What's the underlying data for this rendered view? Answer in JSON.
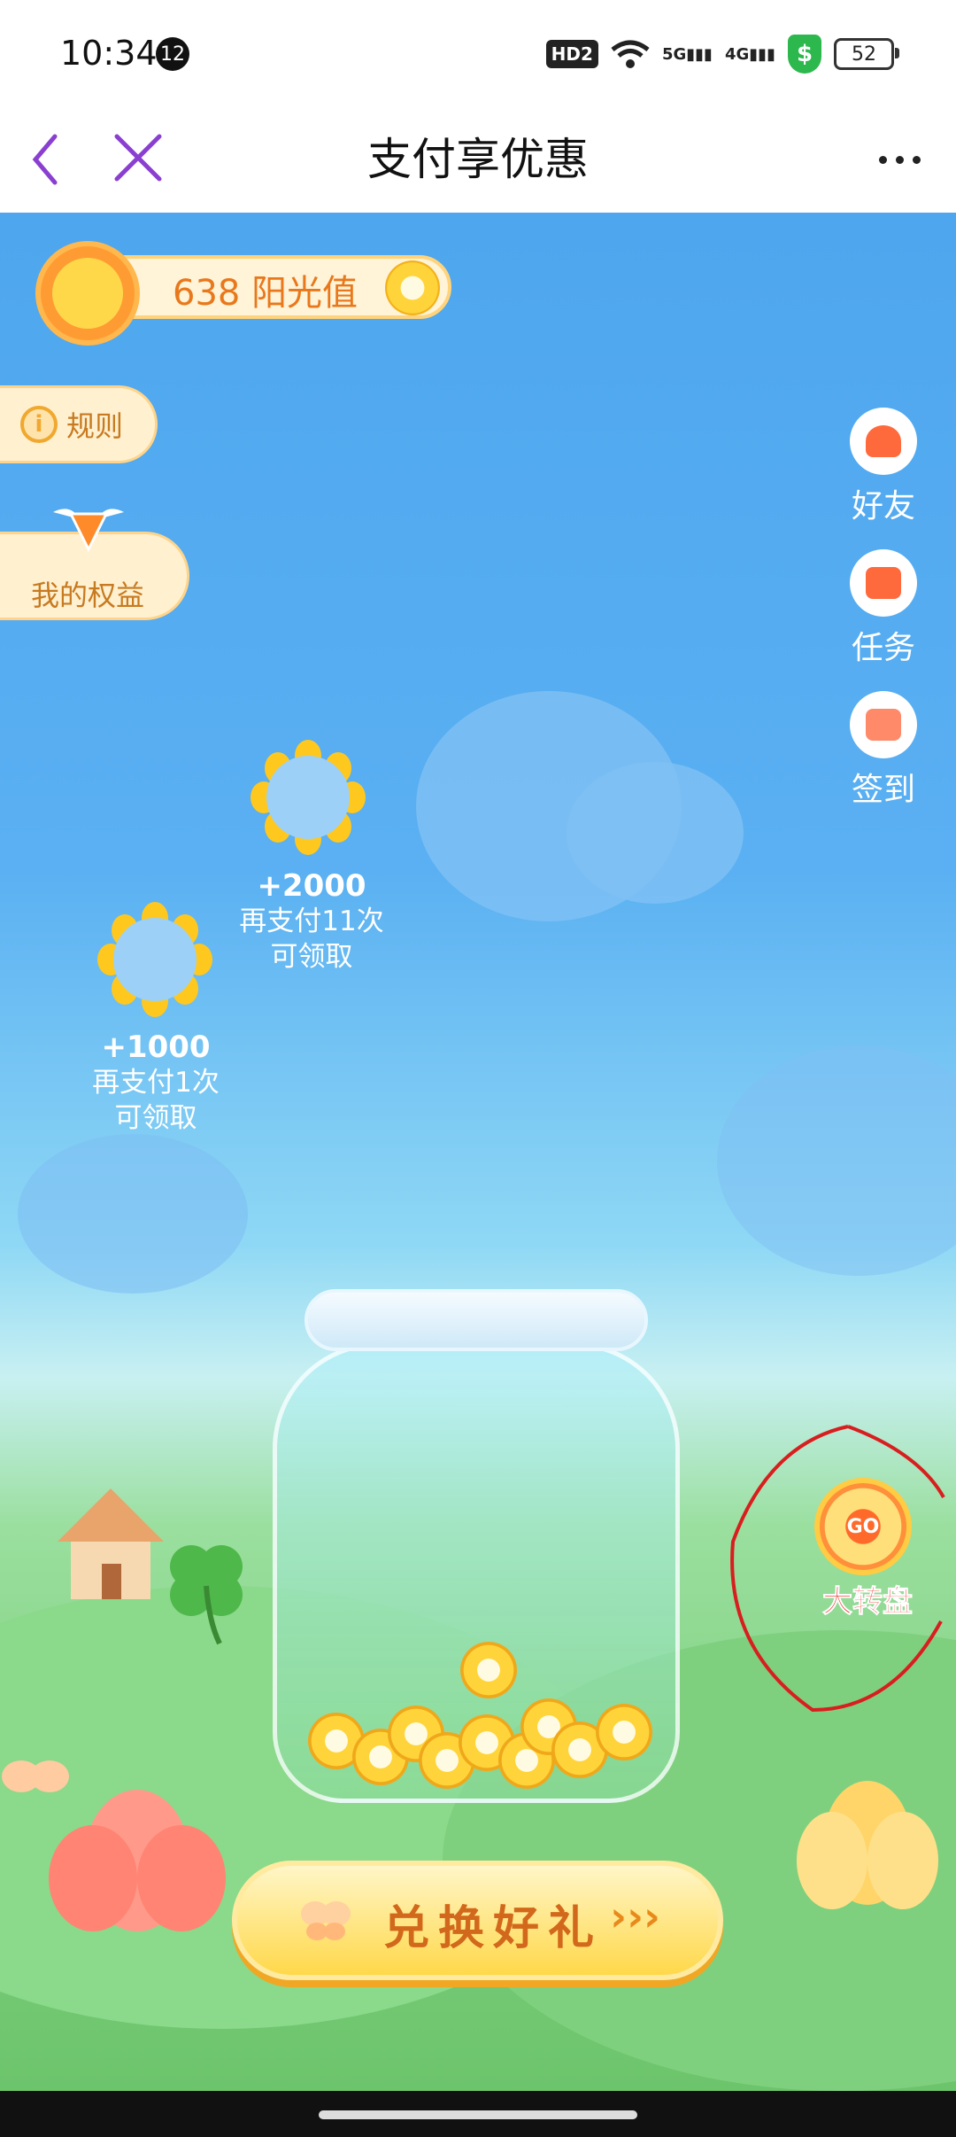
{
  "status_bar": {
    "time": "10:34",
    "notification_count": "12",
    "hd_label": "HD2",
    "network_5g": "5G",
    "network_4g": "4G",
    "battery_level": "52"
  },
  "title_bar": {
    "title": "支付享优惠"
  },
  "points": {
    "value_label": "638 阳光值"
  },
  "left_menu": {
    "rules_label": "规则",
    "benefits_label": "我的权益"
  },
  "right_menu": {
    "friends_label": "好友",
    "tasks_label": "任务",
    "checkin_label": "签到"
  },
  "rewards": [
    {
      "amount": "+2000",
      "line1": "再支付11次",
      "line2": "可领取"
    },
    {
      "amount": "+1000",
      "line1": "再支付1次",
      "line2": "可领取"
    }
  ],
  "wheel": {
    "go_label": "GO",
    "label": "大转盘"
  },
  "redeem": {
    "label": "兑换好礼",
    "arrows": "›››"
  },
  "colors": {
    "accent_purple": "#8a3fd1",
    "points_orange": "#e8781b",
    "sky_blue": "#4ea6ee"
  }
}
